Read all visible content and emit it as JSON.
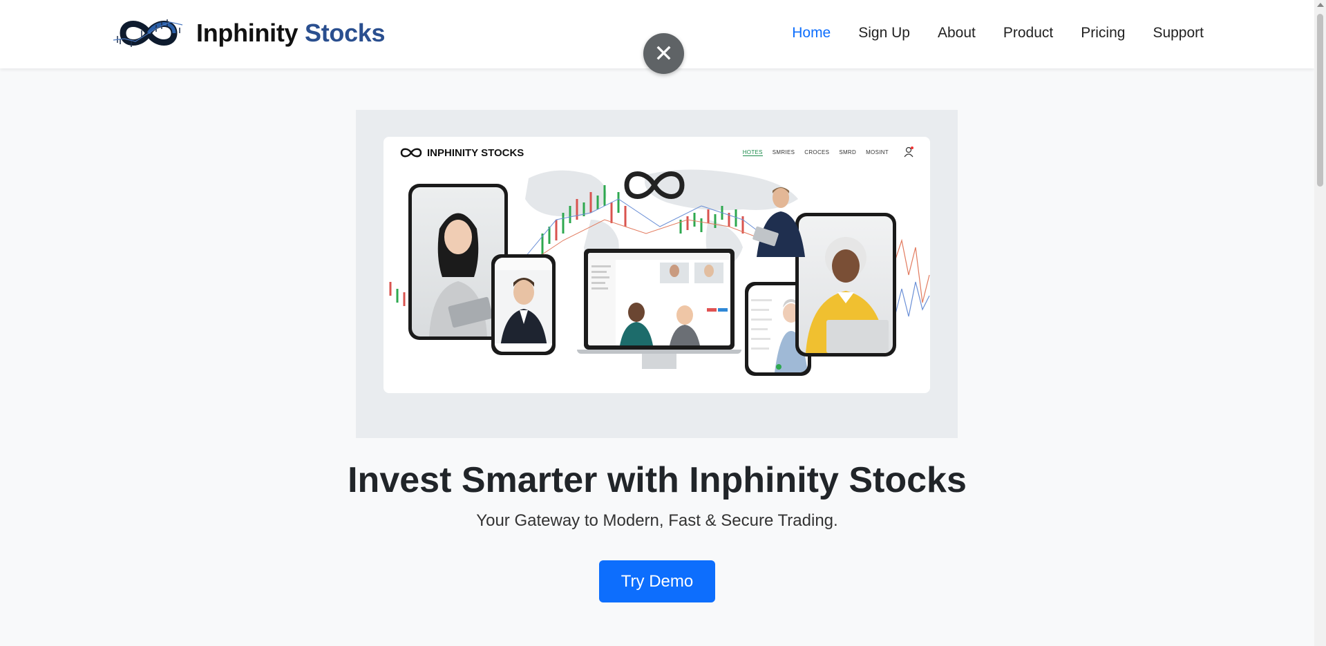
{
  "header": {
    "brand_primary": "Inphinity",
    "brand_secondary": "Stocks",
    "nav": [
      {
        "label": "Home",
        "active": true
      },
      {
        "label": "Sign Up",
        "active": false
      },
      {
        "label": "About",
        "active": false
      },
      {
        "label": "Product",
        "active": false
      },
      {
        "label": "Pricing",
        "active": false
      },
      {
        "label": "Support",
        "active": false
      }
    ]
  },
  "overlay": {
    "close_symbol": "✕"
  },
  "hero_image": {
    "brand": "INPHINITY STOCKS",
    "nav": [
      "HOTES",
      "SMRIES",
      "CROCES",
      "SMRD",
      "MOSINT"
    ]
  },
  "hero": {
    "title": "Invest Smarter with Inphinity Stocks",
    "subtitle": "Your Gateway to Modern, Fast & Secure Trading.",
    "cta_label": "Try Demo"
  },
  "colors": {
    "accent": "#0d6efd",
    "brand_blue": "#2a4f8f",
    "background": "#f8f9fa"
  }
}
